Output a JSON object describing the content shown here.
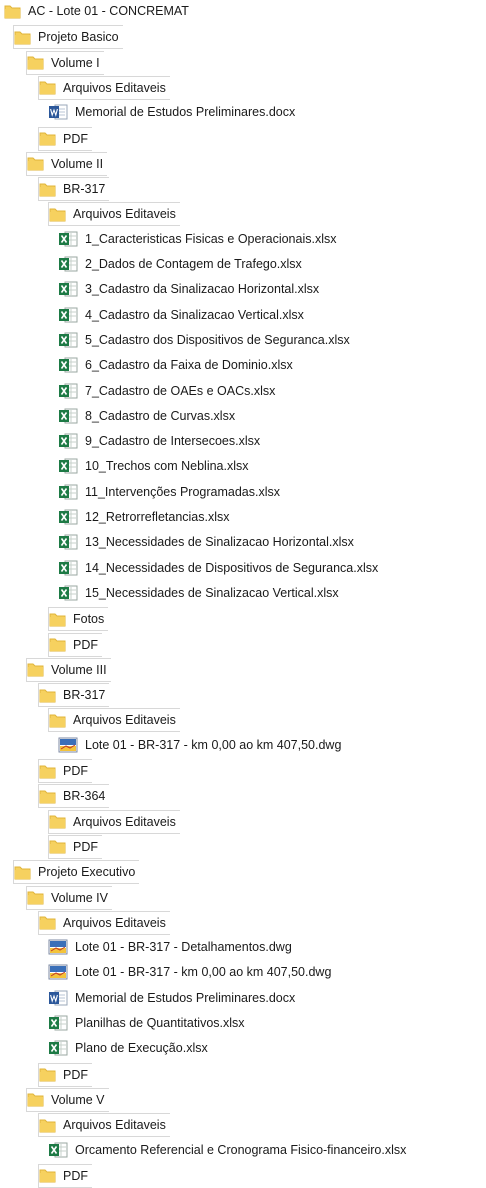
{
  "colors": {
    "folder": "#f6d15f",
    "folder_edge": "#e0b43a",
    "excel": "#1d7a45",
    "word": "#2b579a",
    "dwg": "#3a6fb8"
  },
  "tree": [
    {
      "label": "AC - Lote 01 - CONCREMAT",
      "type": "folder",
      "depth": 0
    },
    {
      "label": "Projeto Basico",
      "type": "folder",
      "depth": 1
    },
    {
      "label": "Volume I",
      "type": "folder",
      "depth": 2
    },
    {
      "label": "Arquivos Editaveis",
      "type": "folder",
      "depth": 3
    },
    {
      "label": "Memorial de Estudos Preliminares.docx",
      "type": "docx",
      "depth": 4
    },
    {
      "label": "PDF",
      "type": "folder",
      "depth": 3
    },
    {
      "label": "Volume II",
      "type": "folder",
      "depth": 2
    },
    {
      "label": "BR-317",
      "type": "folder",
      "depth": 3
    },
    {
      "label": "Arquivos Editaveis",
      "type": "folder",
      "depth": 4
    },
    {
      "label": "1_Caracteristicas Fisicas e Operacionais.xlsx",
      "type": "xlsx",
      "depth": 5
    },
    {
      "label": "2_Dados de Contagem de Trafego.xlsx",
      "type": "xlsx",
      "depth": 5
    },
    {
      "label": "3_Cadastro da Sinalizacao Horizontal.xlsx",
      "type": "xlsx",
      "depth": 5
    },
    {
      "label": "4_Cadastro da Sinalizacao Vertical.xlsx",
      "type": "xlsx",
      "depth": 5
    },
    {
      "label": "5_Cadastro dos Dispositivos de Seguranca.xlsx",
      "type": "xlsx",
      "depth": 5
    },
    {
      "label": "6_Cadastro da Faixa de Dominio.xlsx",
      "type": "xlsx",
      "depth": 5
    },
    {
      "label": "7_Cadastro de OAEs e OACs.xlsx",
      "type": "xlsx",
      "depth": 5
    },
    {
      "label": "8_Cadastro de Curvas.xlsx",
      "type": "xlsx",
      "depth": 5
    },
    {
      "label": "9_Cadastro de Intersecoes.xlsx",
      "type": "xlsx",
      "depth": 5
    },
    {
      "label": "10_Trechos com Neblina.xlsx",
      "type": "xlsx",
      "depth": 5
    },
    {
      "label": "11_Intervenções Programadas.xlsx",
      "type": "xlsx",
      "depth": 5
    },
    {
      "label": "12_Retrorrefletancias.xlsx",
      "type": "xlsx",
      "depth": 5
    },
    {
      "label": "13_Necessidades de Sinalizacao Horizontal.xlsx",
      "type": "xlsx",
      "depth": 5
    },
    {
      "label": "14_Necessidades de Dispositivos de Seguranca.xlsx",
      "type": "xlsx",
      "depth": 5
    },
    {
      "label": "15_Necessidades de Sinalizacao Vertical.xlsx",
      "type": "xlsx",
      "depth": 5
    },
    {
      "label": "Fotos",
      "type": "folder",
      "depth": 4
    },
    {
      "label": "PDF",
      "type": "folder",
      "depth": 4
    },
    {
      "label": "Volume III",
      "type": "folder",
      "depth": 2
    },
    {
      "label": "BR-317",
      "type": "folder",
      "depth": 3
    },
    {
      "label": "Arquivos Editaveis",
      "type": "folder",
      "depth": 4
    },
    {
      "label": "Lote 01 - BR-317 - km 0,00 ao km 407,50.dwg",
      "type": "dwg",
      "depth": 5
    },
    {
      "label": "PDF",
      "type": "folder",
      "depth": 3
    },
    {
      "label": "BR-364",
      "type": "folder",
      "depth": 3
    },
    {
      "label": "Arquivos Editaveis",
      "type": "folder",
      "depth": 4
    },
    {
      "label": "PDF",
      "type": "folder",
      "depth": 4
    },
    {
      "label": "Projeto Executivo",
      "type": "folder",
      "depth": 1
    },
    {
      "label": "Volume IV",
      "type": "folder",
      "depth": 2
    },
    {
      "label": "Arquivos Editaveis",
      "type": "folder",
      "depth": 3
    },
    {
      "label": "Lote 01 - BR-317 - Detalhamentos.dwg",
      "type": "dwg",
      "depth": 4
    },
    {
      "label": "Lote 01 - BR-317 - km 0,00 ao km 407,50.dwg",
      "type": "dwg",
      "depth": 4
    },
    {
      "label": "Memorial de Estudos Preliminares.docx",
      "type": "docx",
      "depth": 4
    },
    {
      "label": "Planilhas de Quantitativos.xlsx",
      "type": "xlsx",
      "depth": 4
    },
    {
      "label": "Plano de Execução.xlsx",
      "type": "xlsx",
      "depth": 4
    },
    {
      "label": "PDF",
      "type": "folder",
      "depth": 3
    },
    {
      "label": "Volume V",
      "type": "folder",
      "depth": 2
    },
    {
      "label": "Arquivos Editaveis",
      "type": "folder",
      "depth": 3
    },
    {
      "label": "Orcamento Referencial e Cronograma Fisico-financeiro.xlsx",
      "type": "xlsx",
      "depth": 4
    },
    {
      "label": "PDF",
      "type": "folder",
      "depth": 3
    }
  ]
}
